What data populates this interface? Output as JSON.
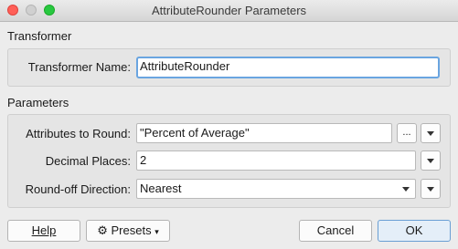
{
  "window": {
    "title": "AttributeRounder Parameters"
  },
  "transformer": {
    "section_label": "Transformer",
    "name_label": "Transformer Name:",
    "name_value": "AttributeRounder"
  },
  "parameters": {
    "section_label": "Parameters",
    "attributes_label": "Attributes to Round:",
    "attributes_value": "\"Percent of Average\"",
    "ellipsis_label": "...",
    "decimal_label": "Decimal Places:",
    "decimal_value": "2",
    "direction_label": "Round-off Direction:",
    "direction_value": "Nearest"
  },
  "footer": {
    "help": "Help",
    "presets": "Presets",
    "cancel": "Cancel",
    "ok": "OK"
  },
  "colors": {
    "accent": "#6aa5e0",
    "close": "#ff5f57",
    "zoom": "#28c840"
  },
  "icons": [
    "gear-icon",
    "chevron-down-icon",
    "ellipsis-icon"
  ]
}
